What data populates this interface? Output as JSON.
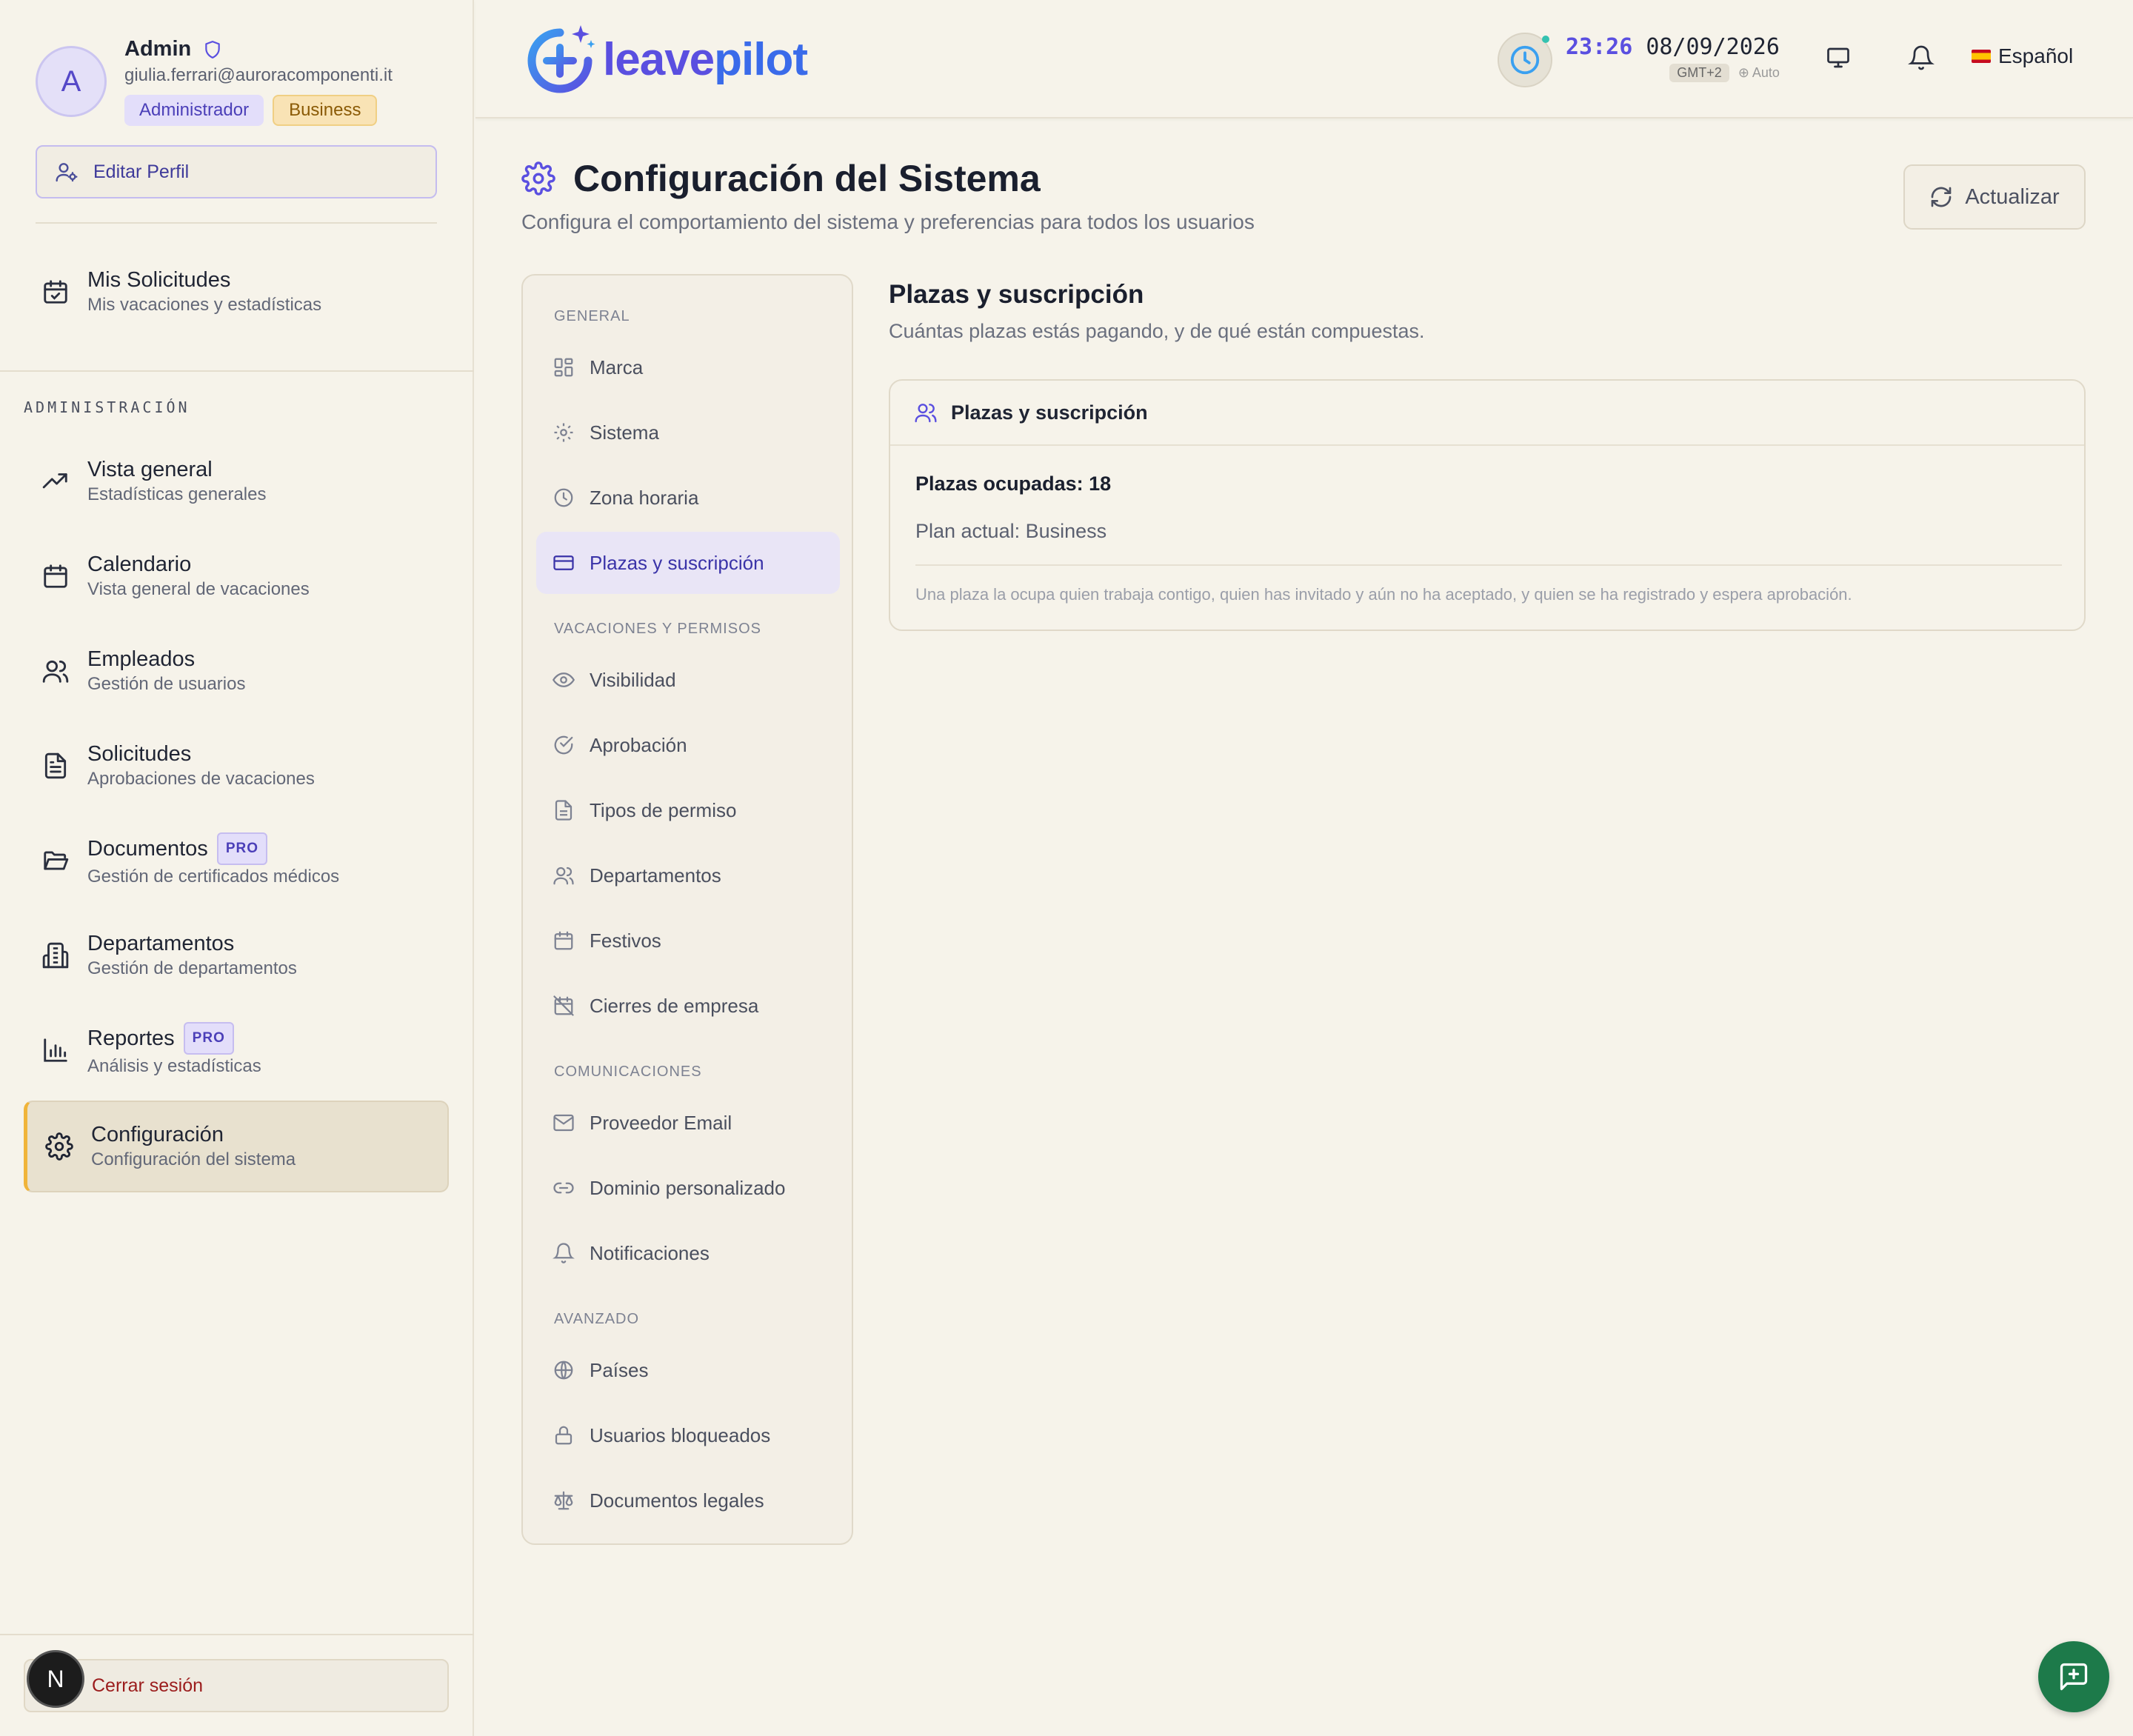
{
  "profile": {
    "initial": "A",
    "name": "Admin",
    "email": "giulia.ferrari@auroracomponenti.it",
    "role_badge": "Administrador",
    "plan_badge": "Business",
    "edit_label": "Editar Perfil"
  },
  "my_requests": {
    "title": "Mis Solicitudes",
    "subtitle": "Mis vacaciones y estadísticas"
  },
  "admin_section_label": "ADMINISTRACIÓN",
  "pro_label": "PRO",
  "nav": [
    {
      "title": "Vista general",
      "subtitle": "Estadísticas generales",
      "icon": "trending-up-icon"
    },
    {
      "title": "Calendario",
      "subtitle": "Vista general de vacaciones",
      "icon": "calendar-icon"
    },
    {
      "title": "Empleados",
      "subtitle": "Gestión de usuarios",
      "icon": "users-icon"
    },
    {
      "title": "Solicitudes",
      "subtitle": "Aprobaciones de vacaciones",
      "icon": "file-text-icon"
    },
    {
      "title": "Documentos",
      "subtitle": "Gestión de certificados médicos",
      "icon": "folder-icon",
      "pro": true
    },
    {
      "title": "Departamentos",
      "subtitle": "Gestión de departamentos",
      "icon": "building-icon"
    },
    {
      "title": "Reportes",
      "subtitle": "Análisis y estadísticas",
      "icon": "bar-chart-icon",
      "pro": true
    },
    {
      "title": "Configuración",
      "subtitle": "Configuración del sistema",
      "icon": "gear-icon",
      "active": true
    }
  ],
  "logout": {
    "avatar_letter": "N",
    "label": "Cerrar sesión"
  },
  "header": {
    "logo_part1": "leave",
    "logo_part2": "pilot",
    "time": "23:26",
    "date": "08/09/2026",
    "timezone": "GMT+2",
    "auto_label": "Auto",
    "language": "Español"
  },
  "page": {
    "title": "Configuración del Sistema",
    "subtitle": "Configura el comportamiento del sistema y preferencias para todos los usuarios",
    "refresh_label": "Actualizar"
  },
  "settings_nav": {
    "sections": [
      "GENERAL",
      "VACACIONES Y PERMISOS",
      "COMUNICACIONES",
      "AVANZADO"
    ],
    "items": [
      "Marca",
      "Sistema",
      "Zona horaria",
      "Plazas y suscripción",
      "Visibilidad",
      "Aprobación",
      "Tipos de permiso",
      "Departamentos",
      "Festivos",
      "Cierres de empresa",
      "Proveedor Email",
      "Dominio personalizado",
      "Notificaciones",
      "Países",
      "Usuarios bloqueados",
      "Documentos legales"
    ],
    "active_item": "Plazas y suscripción"
  },
  "content": {
    "title": "Plazas y suscripción",
    "subtitle": "Cuántas plazas estás pagando, y de qué están compuestas.",
    "card_title": "Plazas y suscripción",
    "occupied": "Plazas ocupadas: 18",
    "plan": "Plan actual: Business",
    "note": "Una plaza la ocupa quien trabaja contigo, quien has invitado y aún no ha aceptado, y quien se ha registrado y espera aprobación."
  },
  "colors": {
    "accent": "#5a4fe0",
    "active_border": "#f0b43a",
    "fab": "#1d7a4a",
    "background": "#f6f3ea"
  }
}
